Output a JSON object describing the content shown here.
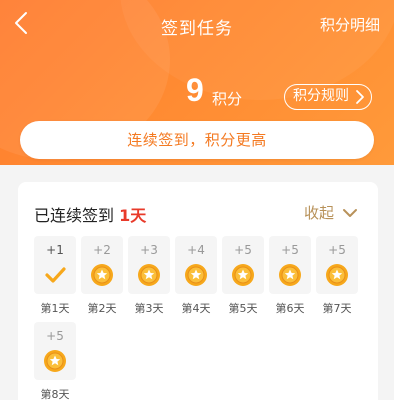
{
  "nav": {
    "title": "签到任务",
    "right_link": "积分明细"
  },
  "points": {
    "value": "9",
    "unit": "积分",
    "rules_label": "积分规则"
  },
  "slogan": "连续签到，积分更高",
  "card": {
    "title_prefix": "已连续签到 ",
    "days": "1天",
    "collapse_label": "收起"
  },
  "days": [
    {
      "points": "+1",
      "label": "第1天",
      "done": true
    },
    {
      "points": "+2",
      "label": "第2天",
      "done": false
    },
    {
      "points": "+3",
      "label": "第3天",
      "done": false
    },
    {
      "points": "+4",
      "label": "第4天",
      "done": false
    },
    {
      "points": "+5",
      "label": "第5天",
      "done": false
    },
    {
      "points": "+5",
      "label": "第6天",
      "done": false
    },
    {
      "points": "+5",
      "label": "第7天",
      "done": false
    },
    {
      "points": "+5",
      "label": "第8天",
      "done": false
    }
  ],
  "colors": {
    "header_orange": "#ff7a2d",
    "slogan_text": "#f47a22",
    "streak_red": "#e83a2a",
    "collapse_gold": "#b8925a",
    "coin_gold": "#f7a81b"
  },
  "icons": {
    "back": "back-arrow-icon",
    "rules_chevron": "chevron-right-icon",
    "collapse_chevron": "chevron-down-icon",
    "checkmark": "checkmark-icon",
    "coin": "star-coin-icon"
  }
}
